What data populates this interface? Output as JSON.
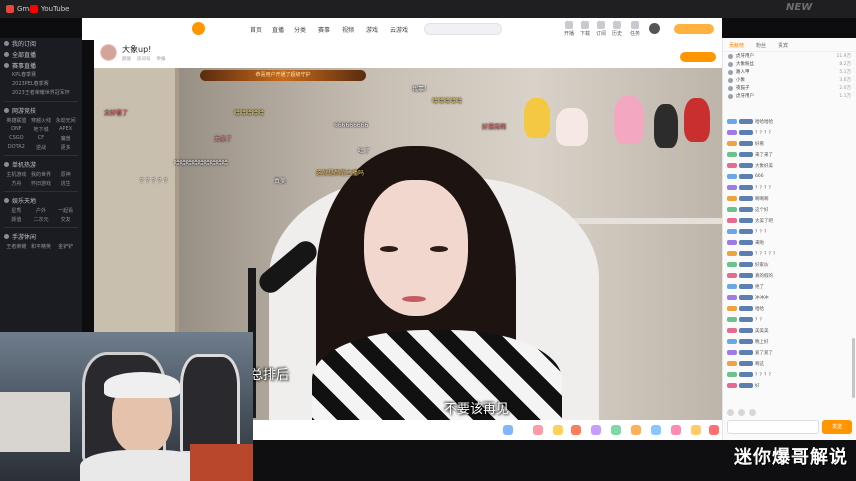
{
  "browser": {
    "bookmarks": [
      {
        "label": "Gmail",
        "color": "#e2483d"
      },
      {
        "label": "YouTube",
        "color": "#ff0000"
      }
    ],
    "corner_logo": "NEW"
  },
  "site_nav": {
    "links": [
      "首页",
      "直播",
      "分类",
      "赛事",
      "视频",
      "游戏",
      "云游戏"
    ],
    "top_icons": [
      "开播",
      "下载",
      "订阅",
      "历史",
      "任务"
    ]
  },
  "sidebar": {
    "sections": [
      {
        "label": "我的订阅",
        "items": []
      },
      {
        "label": "全部直播",
        "items": []
      },
      {
        "label": "赛事直播",
        "items": [
          "KPL春季赛",
          "2023PEL春季赛",
          "2023王者荣耀世界冠军杯"
        ]
      },
      {
        "label": "网游竞技",
        "grid": [
          "英雄联盟",
          "穿越火线",
          "永劫无间",
          "DNF",
          "地下城",
          "APEX",
          "CSGO",
          "CF",
          "魔兽",
          "DOTA2",
          "逆战",
          "更多"
        ]
      },
      {
        "label": "单机热游",
        "grid": [
          "主机游戏",
          "我的世界",
          "原神",
          "方舟",
          "怀旧游戏",
          "逃生"
        ]
      },
      {
        "label": "娱乐天地",
        "grid": [
          "星秀",
          "户外",
          "一起看",
          "颜值",
          "二次元",
          "交友"
        ]
      },
      {
        "label": "手游休闲",
        "grid": [
          "王者荣耀",
          "和平精英",
          "金铲铲"
        ]
      }
    ]
  },
  "room": {
    "title": "大象up!",
    "meta": [
      "颜值",
      "房间号",
      "举报"
    ]
  },
  "video": {
    "banner": "恭喜用户开通了超级守护",
    "danmaku": [
      "我靠！",
      "哈哈哈哈哈",
      "好漂亮啊",
      "哈哈哈哈哈",
      "666666666",
      "哈哈哈哈哈哈哈哈哈",
      "太美了",
      "吐了",
      "这就是颜值主播吗",
      "真美",
      "？？？？？",
      "太好看了"
    ],
    "subtitles": [
      "精彩总排后",
      "不要该再见"
    ]
  },
  "chat": {
    "tabs": [
      "贡献榜",
      "粉丝",
      "贵宾"
    ],
    "rank_rows": [
      {
        "name": "虎牙用户",
        "value": "11.9万"
      },
      {
        "name": "大象粉丝",
        "value": "8.2万"
      },
      {
        "name": "路人甲",
        "value": "5.1万"
      },
      {
        "name": "小象",
        "value": "3.6万"
      },
      {
        "name": "夜猫子",
        "value": "2.0万"
      },
      {
        "name": "虎牙用户",
        "value": "1.1万"
      }
    ],
    "messages": [
      "哈哈哈哈",
      "？？？？",
      "好看",
      "来了来了",
      "大象好美",
      "666",
      "？？？？",
      "啊啊啊",
      "这个好",
      "太美了吧",
      "？？？",
      "来啦",
      "？？？？？",
      "好家伙",
      "真的假的",
      "绝了",
      "冲冲冲",
      "哈哈",
      "？？",
      "美美美",
      "晚上好",
      "爱了爱了",
      "啊这",
      "？？？？",
      "好"
    ],
    "send_label": "发送"
  },
  "cam": {
    "watermark": "迷你爆哥解说"
  }
}
